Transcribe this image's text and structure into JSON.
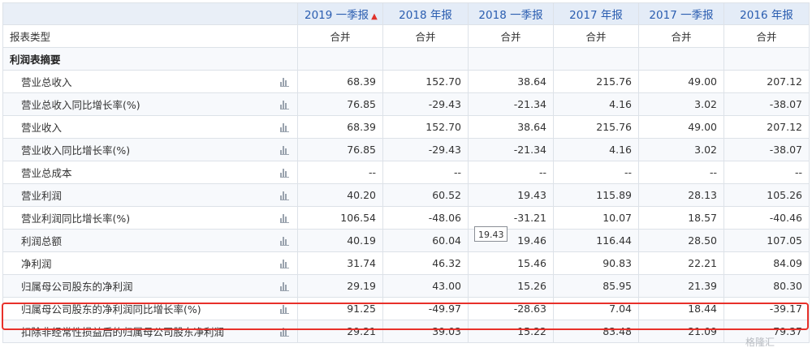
{
  "periods": [
    "2019 一季报",
    "2018 年报",
    "2018 一季报",
    "2017 年报",
    "2017 一季报",
    "2016 年报"
  ],
  "report_type": {
    "label": "报表类型",
    "values": [
      "合并",
      "合并",
      "合并",
      "合并",
      "合并",
      "合并"
    ]
  },
  "section_title": "利润表摘要",
  "rows": [
    {
      "label": "营业总收入",
      "values": [
        "68.39",
        "152.70",
        "38.64",
        "215.76",
        "49.00",
        "207.12"
      ]
    },
    {
      "label": "营业总收入同比增长率(%)",
      "values": [
        "76.85",
        "-29.43",
        "-21.34",
        "4.16",
        "3.02",
        "-38.07"
      ]
    },
    {
      "label": "营业收入",
      "values": [
        "68.39",
        "152.70",
        "38.64",
        "215.76",
        "49.00",
        "207.12"
      ]
    },
    {
      "label": "营业收入同比增长率(%)",
      "values": [
        "76.85",
        "-29.43",
        "-21.34",
        "4.16",
        "3.02",
        "-38.07"
      ]
    },
    {
      "label": "营业总成本",
      "values": [
        "--",
        "--",
        "--",
        "--",
        "--",
        "--"
      ]
    },
    {
      "label": "营业利润",
      "values": [
        "40.20",
        "60.52",
        "19.43",
        "115.89",
        "28.13",
        "105.26"
      ]
    },
    {
      "label": "营业利润同比增长率(%)",
      "values": [
        "106.54",
        "-48.06",
        "-31.21",
        "10.07",
        "18.57",
        "-40.46"
      ]
    },
    {
      "label": "利润总额",
      "values": [
        "40.19",
        "60.04",
        "19.46",
        "116.44",
        "28.50",
        "107.05"
      ]
    },
    {
      "label": "净利润",
      "values": [
        "31.74",
        "46.32",
        "15.46",
        "90.83",
        "22.21",
        "84.09"
      ]
    },
    {
      "label": "归属母公司股东的净利润",
      "values": [
        "29.19",
        "43.00",
        "15.26",
        "85.95",
        "21.39",
        "80.30"
      ]
    },
    {
      "label": "归属母公司股东的净利润同比增长率(%)",
      "values": [
        "91.25",
        "-49.97",
        "-28.63",
        "7.04",
        "18.44",
        "-39.17"
      ]
    },
    {
      "label": "扣除非经常性损益后的归属母公司股东净利润",
      "values": [
        "29.21",
        "39.03",
        "15.22",
        "83.48",
        "21.09",
        "79.37"
      ]
    }
  ],
  "tooltip": "19.43",
  "watermark": "格隆汇",
  "colors": {
    "header_bg": "#e4ecf7",
    "header_text": "#2a5db0",
    "highlight": "#e8302a",
    "flag": "#e0322b"
  }
}
